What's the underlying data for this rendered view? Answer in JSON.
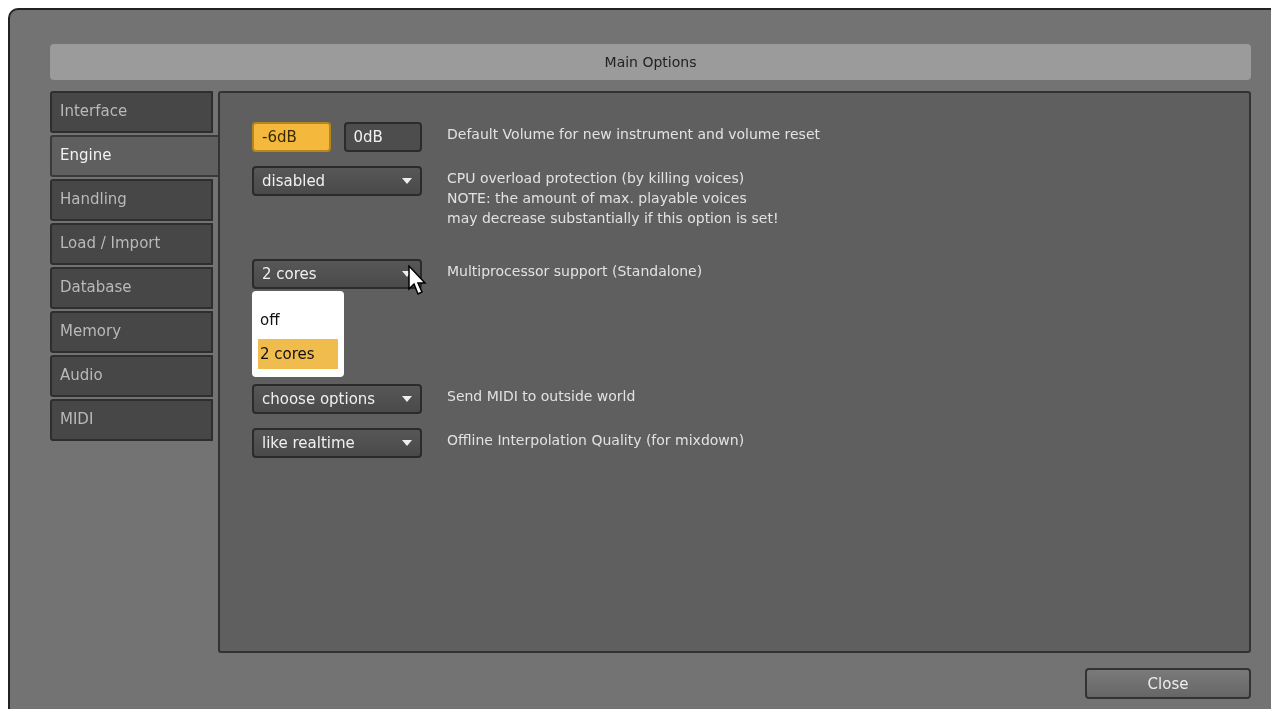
{
  "window": {
    "title": "Main Options"
  },
  "tabs": [
    {
      "label": "Interface",
      "selected": false
    },
    {
      "label": "Engine",
      "selected": true
    },
    {
      "label": "Handling",
      "selected": false
    },
    {
      "label": "Load / Import",
      "selected": false
    },
    {
      "label": "Database",
      "selected": false
    },
    {
      "label": "Memory",
      "selected": false
    },
    {
      "label": "Audio",
      "selected": false
    },
    {
      "label": "MIDI",
      "selected": false
    }
  ],
  "settings": [
    {
      "kind": "buttons",
      "buttons": [
        {
          "label": "-6dB",
          "selected": true
        },
        {
          "label": "0dB",
          "selected": false
        }
      ],
      "description": [
        "Default Volume for new instrument and volume reset"
      ]
    },
    {
      "kind": "dropdown",
      "value": "disabled",
      "description": [
        "CPU overload protection (by killing voices)",
        "NOTE: the amount of max. playable voices",
        "may decrease substantially if this option is set!"
      ]
    },
    {
      "kind": "dropdown",
      "value": "2 cores",
      "expanded": true,
      "options": [
        {
          "label": "off",
          "selected": false
        },
        {
          "label": "2 cores",
          "selected": true
        }
      ],
      "description": [
        "Multiprocessor support  (Standalone)"
      ]
    },
    {
      "kind": "dropdown",
      "value": "choose options",
      "description": [
        "Send MIDI to outside world"
      ]
    },
    {
      "kind": "dropdown",
      "value": "like realtime",
      "description": [
        "Offline Interpolation Quality (for mixdown)"
      ]
    }
  ],
  "footer": {
    "close_button": "Close"
  }
}
